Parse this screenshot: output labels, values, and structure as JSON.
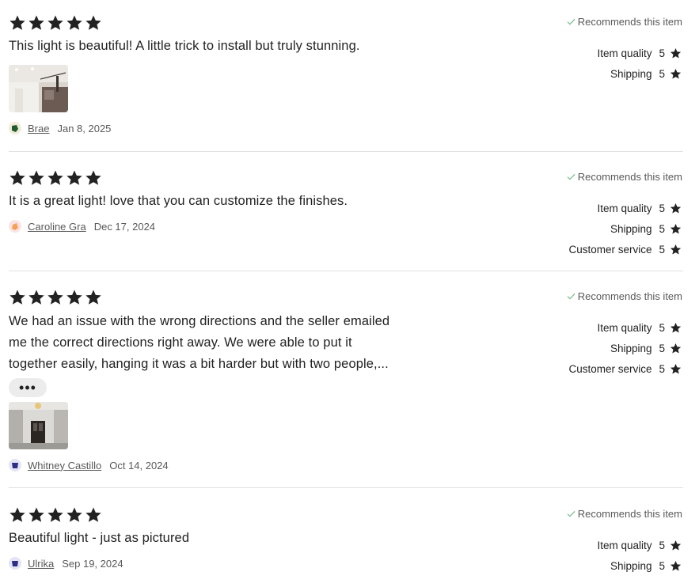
{
  "reviews": [
    {
      "stars": 5,
      "text": "This light is beautiful! A little trick to install but truly stunning.",
      "reviewer": "Brae",
      "date": "Jan 8, 2025",
      "recommends": "Recommends this item",
      "ratings": [
        {
          "label": "Item quality",
          "value": "5"
        },
        {
          "label": "Shipping",
          "value": "5"
        }
      ]
    },
    {
      "stars": 5,
      "text": "It is a great light! love that you can customize the finishes.",
      "reviewer": "Caroline Gra",
      "date": "Dec 17, 2024",
      "recommends": "Recommends this item",
      "ratings": [
        {
          "label": "Item quality",
          "value": "5"
        },
        {
          "label": "Shipping",
          "value": "5"
        },
        {
          "label": "Customer service",
          "value": "5"
        }
      ]
    },
    {
      "stars": 5,
      "text_lines": [
        "We had an issue with the wrong directions and the seller emailed",
        "me the correct directions right away. We were able to put it",
        "together easily, hanging it was a bit harder but with two people,..."
      ],
      "more_label": "•••",
      "reviewer": "Whitney Castillo",
      "date": "Oct 14, 2024",
      "recommends": "Recommends this item",
      "ratings": [
        {
          "label": "Item quality",
          "value": "5"
        },
        {
          "label": "Shipping",
          "value": "5"
        },
        {
          "label": "Customer service",
          "value": "5"
        }
      ]
    },
    {
      "stars": 5,
      "text": "Beautiful light - just as pictured",
      "reviewer": "Ulrika",
      "date": "Sep 19, 2024",
      "recommends": "Recommends this item",
      "ratings": [
        {
          "label": "Item quality",
          "value": "5"
        },
        {
          "label": "Shipping",
          "value": "5"
        }
      ]
    }
  ],
  "colors": {
    "text": "#222222",
    "muted": "#595959",
    "check": "#7bbd8d",
    "divider": "#e1e1e1",
    "avatar_brae": "#1f5c2f",
    "avatar_caroline": "#f4a259",
    "avatar_whitney": "#2d2f86",
    "avatar_ulrika": "#2d2f86"
  },
  "icons": [
    "star-icon",
    "check-icon",
    "more-icon",
    "avatar-icon"
  ]
}
